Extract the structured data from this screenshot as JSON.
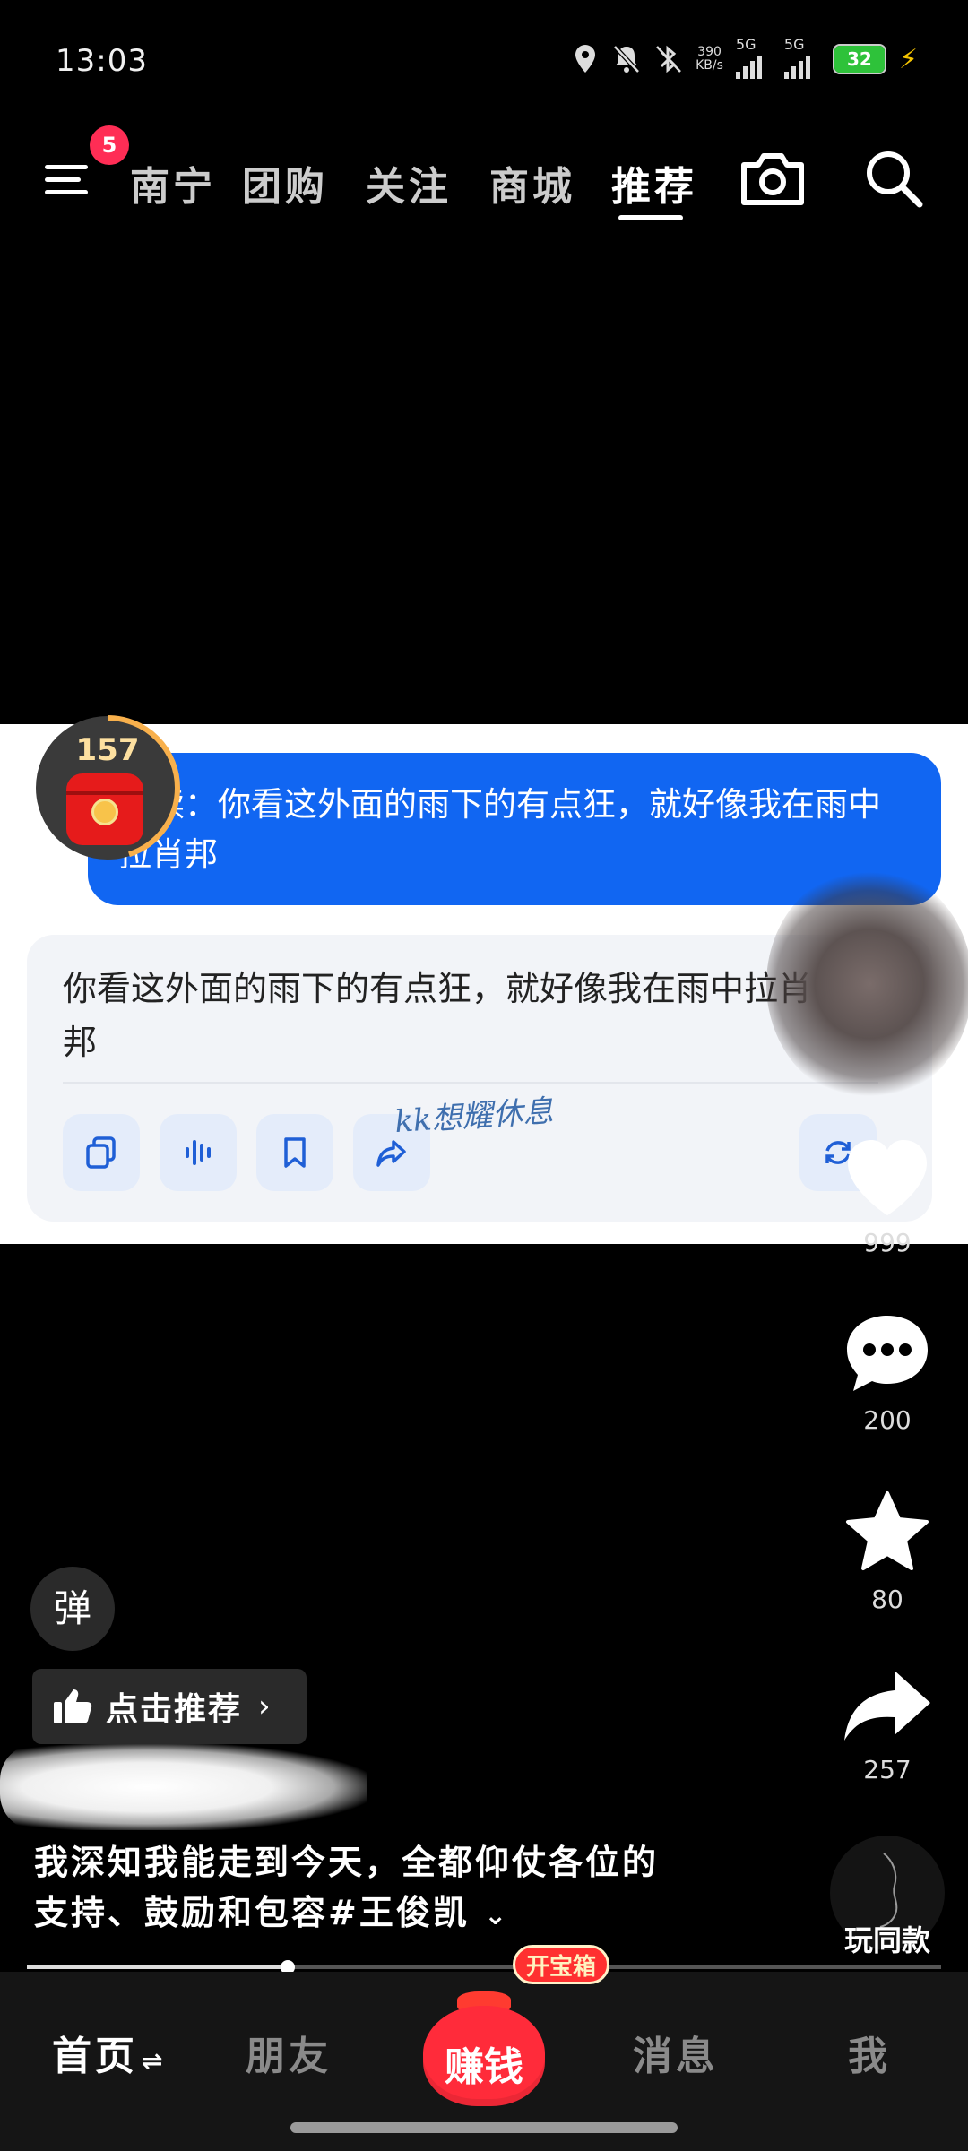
{
  "status_bar": {
    "time": "13:03",
    "net_speed_value": "390",
    "net_speed_unit": "KB/s",
    "signal1_label": "5G",
    "signal2_label": "5G",
    "battery": "32",
    "icons": [
      "location-icon",
      "bell-mute-icon",
      "bluetooth-icon",
      "signal-icon",
      "signal-icon",
      "battery-icon",
      "charging-bolt-icon"
    ]
  },
  "top_nav": {
    "menu_badge": "5",
    "tabs": [
      {
        "label": "南宁"
      },
      {
        "label": "团购"
      },
      {
        "label": "关注"
      },
      {
        "label": "商城"
      },
      {
        "label": "推荐"
      }
    ],
    "active_tab": "推荐",
    "icons": [
      "menu-icon",
      "camera-icon",
      "search-icon"
    ]
  },
  "red_packet": {
    "count": "157",
    "progress": 0.45,
    "ring_color": "#f8b04c"
  },
  "card": {
    "question": "朗读：你看这外面的雨下的有点狂，就好像我在雨中拉肖邦",
    "answer": "你看这外面的雨下的有点狂，就好像我在雨中拉肖邦",
    "watermark": "kk想耀休息",
    "actions": [
      "copy-icon",
      "voice-icon",
      "bookmark-icon",
      "share-icon",
      "refresh-icon"
    ],
    "bubble_color": "#1166f2"
  },
  "right_rail": {
    "like_count": "999",
    "comment_count": "200",
    "favorite_count": "80",
    "share_count": "257",
    "play_same_label": "玩同款"
  },
  "overlay": {
    "danmu_label": "弹",
    "recommend_label": "点击推荐",
    "caption_line1": "我深知我能走到今天，全都仰仗各位的",
    "caption_line2": "支持、鼓励和包容#王俊凯"
  },
  "progress": {
    "fraction": 0.285
  },
  "bottom_nav": {
    "home": "首页",
    "friends": "朋友",
    "earn": "赚钱",
    "earn_badge": "开宝箱",
    "messages": "消息",
    "me": "我"
  }
}
